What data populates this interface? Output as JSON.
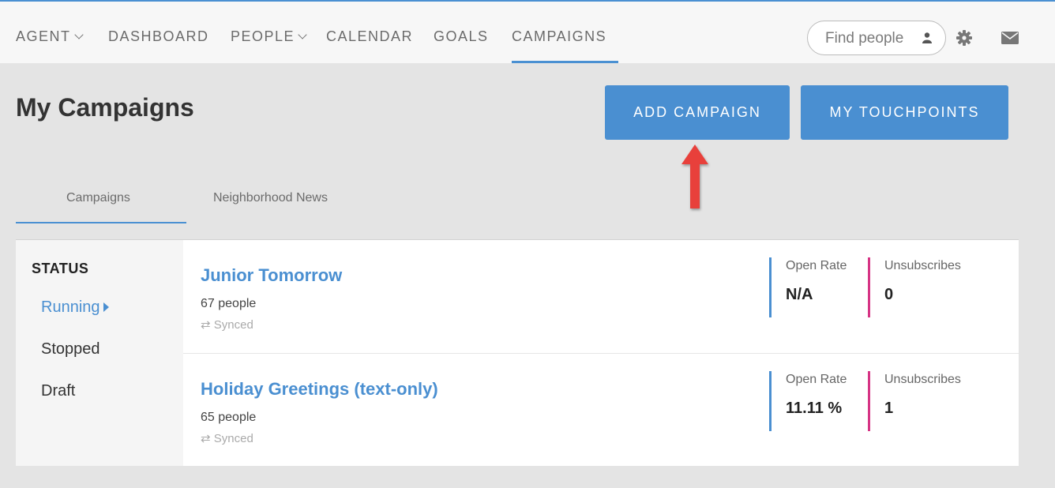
{
  "nav": {
    "items": [
      {
        "label": "AGENT",
        "dropdown": true
      },
      {
        "label": "DASHBOARD",
        "dropdown": false
      },
      {
        "label": "PEOPLE",
        "dropdown": true
      },
      {
        "label": "CALENDAR",
        "dropdown": false
      },
      {
        "label": "GOALS",
        "dropdown": false
      },
      {
        "label": "CAMPAIGNS",
        "dropdown": false,
        "active": true
      }
    ],
    "search_placeholder": "Find people",
    "icons": [
      "person-icon",
      "gear-icon",
      "mail-icon"
    ]
  },
  "header": {
    "title": "My Campaigns",
    "add_button": "ADD CAMPAIGN",
    "touchpoints_button": "MY TOUCHPOINTS"
  },
  "tabs": [
    {
      "label": "Campaigns",
      "active": true
    },
    {
      "label": "Neighborhood News",
      "active": false
    }
  ],
  "sidebar": {
    "title": "STATUS",
    "items": [
      {
        "label": "Running",
        "active": true
      },
      {
        "label": "Stopped",
        "active": false
      },
      {
        "label": "Draft",
        "active": false
      }
    ]
  },
  "campaigns": [
    {
      "name": "Junior Tomorrow",
      "people": "67 people",
      "sync": "Synced",
      "open_rate_label": "Open Rate",
      "open_rate": "N/A",
      "unsub_label": "Unsubscribes",
      "unsub": "0"
    },
    {
      "name": "Holiday Greetings (text-only)",
      "people": "65 people",
      "sync": "Synced",
      "open_rate_label": "Open Rate",
      "open_rate": "11.11 %",
      "unsub_label": "Unsubscribes",
      "unsub": "1"
    }
  ],
  "colors": {
    "accent": "#4a8fd1",
    "unsub": "#d63384",
    "arrow": "#e8413a"
  }
}
